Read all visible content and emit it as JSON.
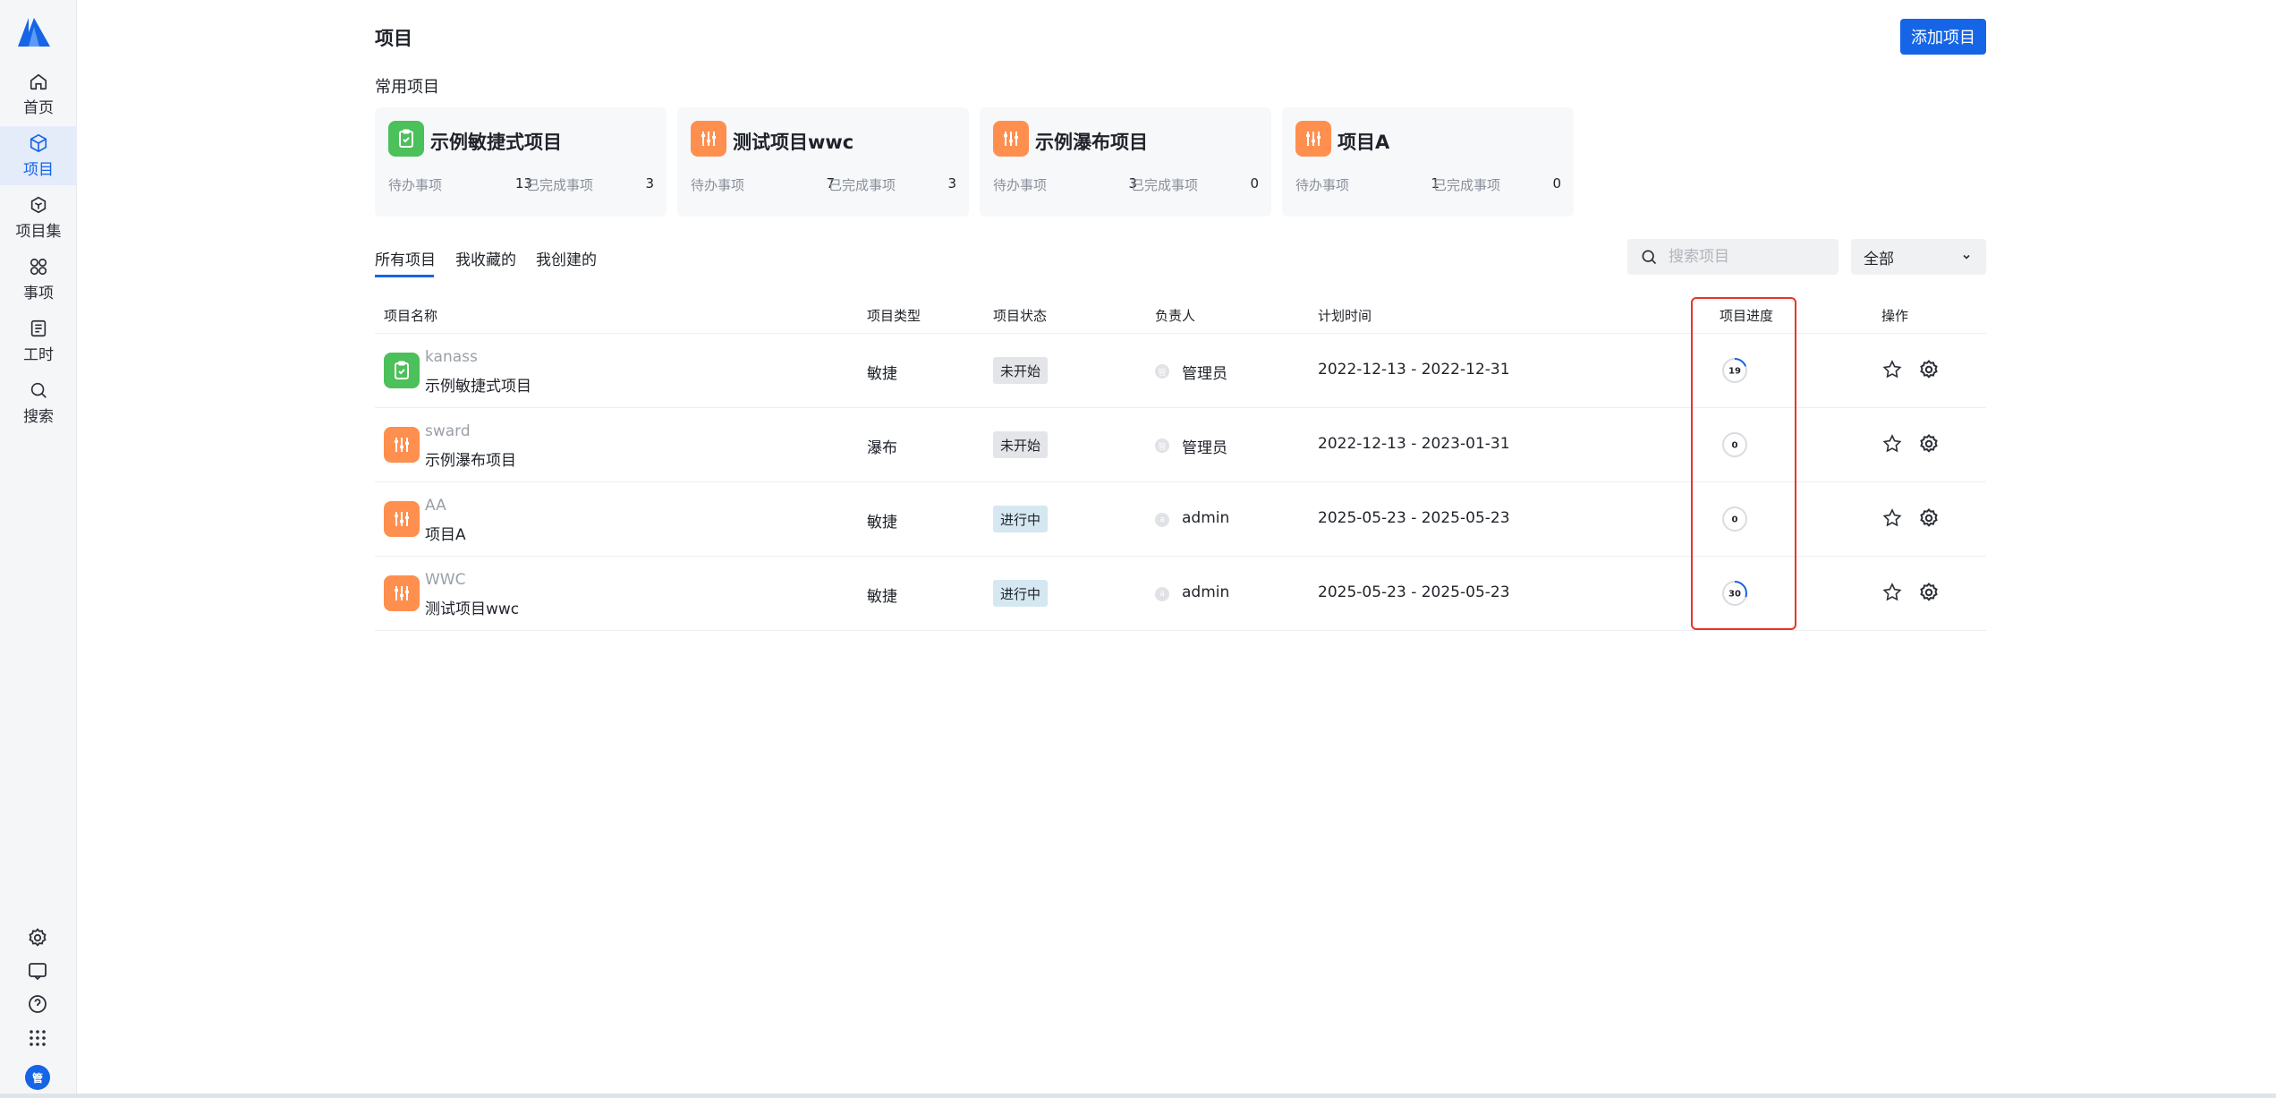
{
  "sidebar": {
    "items": [
      {
        "label": "首页",
        "icon": "home-icon"
      },
      {
        "label": "项目",
        "icon": "cube-icon",
        "active": true
      },
      {
        "label": "项目集",
        "icon": "project-set-icon"
      },
      {
        "label": "事项",
        "icon": "issue-icon"
      },
      {
        "label": "工时",
        "icon": "timesheet-icon"
      },
      {
        "label": "搜索",
        "icon": "search-icon"
      }
    ],
    "bottom_icons": [
      "settings-icon",
      "message-icon",
      "help-icon",
      "apps-grid-icon"
    ],
    "avatar_text": "管"
  },
  "header": {
    "title": "项目",
    "add_button": "添加项目"
  },
  "recent": {
    "title": "常用项目",
    "todo_label": "待办事项",
    "done_label": "已完成事项",
    "cards": [
      {
        "name": "示例敏捷式项目",
        "todo": "13",
        "done": "3",
        "icon": "clipboard-icon",
        "color": "#4cc05a"
      },
      {
        "name": "测试项目wwc",
        "todo": "7",
        "done": "3",
        "icon": "sliders-icon",
        "color": "#ff8f4f"
      },
      {
        "name": "示例瀑布项目",
        "todo": "3",
        "done": "0",
        "icon": "sliders-icon",
        "color": "#ff8f4f"
      },
      {
        "name": "项目A",
        "todo": "1",
        "done": "0",
        "icon": "sliders-icon",
        "color": "#ff8f4f"
      }
    ]
  },
  "tabs": [
    {
      "label": "所有项目",
      "active": true
    },
    {
      "label": "我收藏的"
    },
    {
      "label": "我创建的"
    }
  ],
  "search": {
    "placeholder": "搜索项目"
  },
  "filter": {
    "selected": "全部"
  },
  "table": {
    "headers": {
      "name": "项目名称",
      "type": "项目类型",
      "status": "项目状态",
      "owner": "负责人",
      "time": "计划时间",
      "progress": "项目进度",
      "actions": "操作"
    },
    "rows": [
      {
        "key": "kanass",
        "name": "示例敏捷式项目",
        "type": "敏捷",
        "status": "未开始",
        "status_color": "gray",
        "owner": "管理员",
        "owner_initial": "管",
        "time": "2022-12-13 - 2022-12-31",
        "progress": "19",
        "progress_fraction": 0.19,
        "icon": "clipboard-icon",
        "color": "#4cc05a"
      },
      {
        "key": "sward",
        "name": "示例瀑布项目",
        "type": "瀑布",
        "status": "未开始",
        "status_color": "gray",
        "owner": "管理员",
        "owner_initial": "管",
        "time": "2022-12-13 - 2023-01-31",
        "progress": "0",
        "progress_fraction": 0,
        "icon": "sliders-icon",
        "color": "#ff8f4f"
      },
      {
        "key": "AA",
        "name": "项目A",
        "type": "敏捷",
        "status": "进行中",
        "status_color": "blue",
        "owner": "admin",
        "owner_initial": "a",
        "time": "2025-05-23 - 2025-05-23",
        "progress": "0",
        "progress_fraction": 0,
        "icon": "sliders-icon",
        "color": "#ff8f4f"
      },
      {
        "key": "WWC",
        "name": "测试项目wwc",
        "type": "敏捷",
        "status": "进行中",
        "status_color": "blue",
        "owner": "admin",
        "owner_initial": "a",
        "time": "2025-05-23 - 2025-05-23",
        "progress": "30",
        "progress_fraction": 0.3,
        "icon": "sliders-icon",
        "color": "#ff8f4f"
      }
    ]
  },
  "colors": {
    "accent": "#1565e6",
    "highlight": "#e8332a"
  }
}
